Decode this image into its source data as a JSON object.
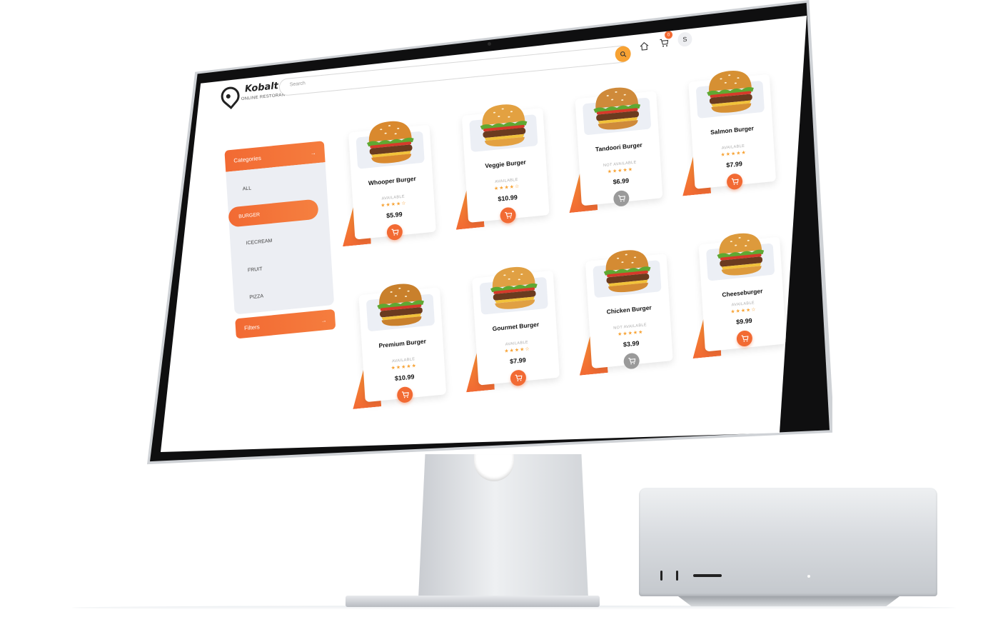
{
  "app": {
    "brand_name": "Kobalt",
    "brand_tagline": "ONLINE RESTORAN",
    "search_placeholder": "Search",
    "cart_count": "0",
    "user_initial": "S"
  },
  "sidebar": {
    "categories_label": "Categories",
    "categories_arrow": "→",
    "items": [
      {
        "label": "ALL"
      },
      {
        "label": "BURGER",
        "active": true
      },
      {
        "label": "ICECREAM"
      },
      {
        "label": "FRUIT"
      },
      {
        "label": "PIZZA"
      }
    ],
    "filters_label": "Filters",
    "filters_arrow": "→"
  },
  "products": [
    {
      "name": "Whooper Burger",
      "status": "AVAILABLE",
      "rating_text": "★★★★☆",
      "rating": 4,
      "price": "$5.99",
      "available": true
    },
    {
      "name": "Veggie Burger",
      "status": "AVAILABLE",
      "rating_text": "★★★★☆",
      "rating": 4,
      "price": "$10.99",
      "available": true
    },
    {
      "name": "Tandoori Burger",
      "status": "NOT AVAILABLE",
      "rating_text": "★★★★★",
      "rating": 5,
      "price": "$6.99",
      "available": false
    },
    {
      "name": "Salmon Burger",
      "status": "AVAILABLE",
      "rating_text": "★★★★★",
      "rating": 5,
      "price": "$7.99",
      "available": true
    },
    {
      "name": "Premium Burger",
      "status": "AVAILABLE",
      "rating_text": "★★★★★",
      "rating": 5,
      "price": "$10.99",
      "available": true
    },
    {
      "name": "Gourmet Burger",
      "status": "AVAILABLE",
      "rating_text": "★★★★☆",
      "rating": 4,
      "price": "$7.99",
      "available": true
    },
    {
      "name": "Chicken Burger",
      "status": "NOT AVAILABLE",
      "rating_text": "★★★★★",
      "rating": 5,
      "price": "$3.99",
      "available": false
    },
    {
      "name": "Cheeseburger",
      "status": "AVAILABLE",
      "rating_text": "★★★★☆",
      "rating": 4,
      "price": "$9.99",
      "available": true
    }
  ],
  "colors": {
    "accent": "#f26a33",
    "accent_light": "#f9b233",
    "disabled": "#9a9a9a",
    "sidebar_bg": "#eceef3"
  },
  "icons": {
    "search": "search-icon",
    "home": "home-icon",
    "cart": "cart-icon",
    "arrow": "arrow-right-icon"
  }
}
